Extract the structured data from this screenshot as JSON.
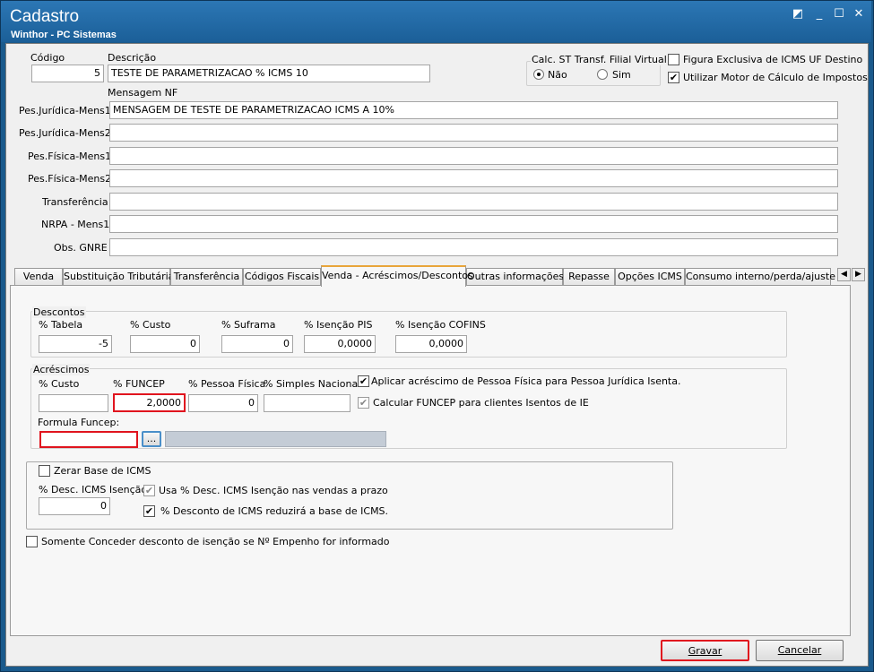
{
  "window": {
    "title": "Cadastro",
    "subtitle": "Winthor - PC Sistemas"
  },
  "header": {
    "codigo_label": "Código",
    "codigo_value": "5",
    "descricao_label": "Descrição",
    "descricao_value": "TESTE DE PARAMETRIZACAO % ICMS 10",
    "calc_st": {
      "title": "Calc. ST Transf. Filial Virtual",
      "option_nao": "Não",
      "option_sim": "Sim",
      "selected": "Não"
    },
    "figura_exclusiva": {
      "label": "Figura Exclusiva de ICMS UF Destino",
      "checked": false
    },
    "utilizar_motor": {
      "label": "Utilizar Motor de Cálculo de Impostos",
      "checked": true
    }
  },
  "mensagem": {
    "section_label": "Mensagem NF",
    "rows": [
      {
        "label": "Pes.Jurídica-Mens1",
        "value": "MENSAGEM DE TESTE DE PARAMETRIZACAO ICMS A 10%"
      },
      {
        "label": "Pes.Jurídica-Mens2",
        "value": ""
      },
      {
        "label": "Pes.Física-Mens1",
        "value": ""
      },
      {
        "label": "Pes.Física-Mens2",
        "value": ""
      },
      {
        "label": "Transferência",
        "value": ""
      },
      {
        "label": "NRPA - Mens1",
        "value": ""
      },
      {
        "label": "Obs. GNRE",
        "value": ""
      }
    ]
  },
  "tabs": [
    "Venda",
    "Substituição Tributária",
    "Transferência",
    "Códigos Fiscais",
    "Venda - Acréscimos/Descontos",
    "Outras informações",
    "Repasse",
    "Opções ICMS",
    "Consumo interno/perda/ajuste"
  ],
  "active_tab": "Venda - Acréscimos/Descontos",
  "descontos": {
    "title": "Descontos",
    "fields": [
      {
        "label": "% Tabela",
        "value": "-5"
      },
      {
        "label": "% Custo",
        "value": "0"
      },
      {
        "label": "% Suframa",
        "value": "0"
      },
      {
        "label": "% Isenção PIS",
        "value": "0,0000"
      },
      {
        "label": "% Isenção COFINS",
        "value": "0,0000"
      }
    ]
  },
  "acrescimos": {
    "title": "Acréscimos",
    "fields": [
      {
        "label": "% Custo",
        "value": ""
      },
      {
        "label": "% FUNCEP",
        "value": "2,0000"
      },
      {
        "label": "% Pessoa Física",
        "value": "0"
      },
      {
        "label": "% Simples Nacional",
        "value": ""
      }
    ],
    "aplicar_acrescimo": {
      "label": "Aplicar acréscimo de Pessoa Física para Pessoa Jurídica Isenta.",
      "checked": true
    },
    "calcular_funcep": {
      "label": "Calcular FUNCEP para clientes Isentos de IE",
      "checked": true
    },
    "formula_label": "Formula Funcep:",
    "formula_value": "",
    "formula_button": "..."
  },
  "zerar": {
    "zerar_base": {
      "label": "Zerar Base de ICMS",
      "checked": false
    },
    "desc_label": "% Desc. ICMS Isenção",
    "desc_value": "0",
    "usa_desc": {
      "label": "Usa % Desc. ICMS Isenção nas vendas a prazo",
      "checked": true
    },
    "reduz_base": {
      "label": "% Desconto de ICMS reduzirá a base de ICMS.",
      "checked": true
    }
  },
  "somente_conceder": {
    "label": "Somente Conceder desconto de isenção se Nº Empenho for informado",
    "checked": false
  },
  "buttons": {
    "gravar": "Gravar",
    "cancelar": "Cancelar"
  }
}
